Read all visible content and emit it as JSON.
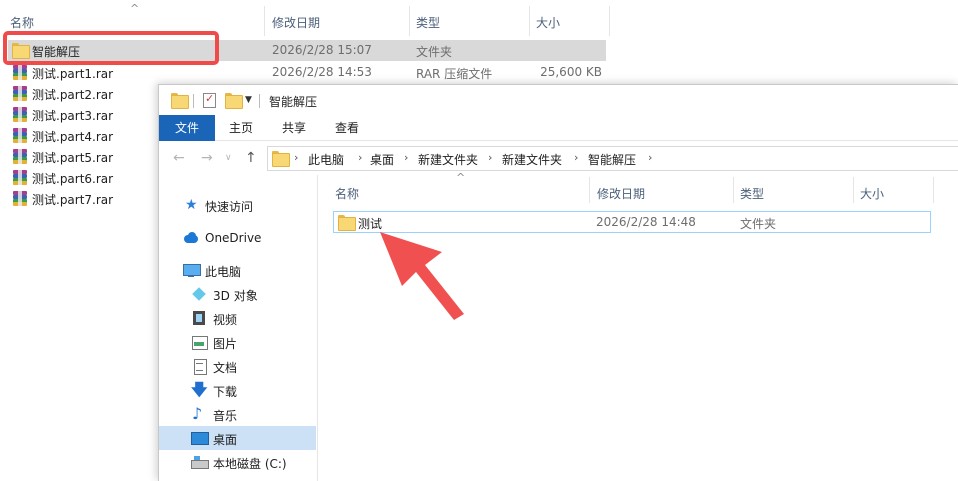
{
  "background": {
    "columns": {
      "name": "名称",
      "date": "修改日期",
      "type": "类型",
      "size": "大小"
    },
    "sort_arrow": "^",
    "rows": [
      {
        "name": "智能解压",
        "date": "2026/2/28 15:07",
        "type": "文件夹",
        "size": "",
        "icon": "folder-icon"
      },
      {
        "name": "测试.part1.rar",
        "date": "2026/2/28 14:53",
        "type": "RAR 压缩文件",
        "size": "25,600 KB",
        "icon": "rar-icon"
      },
      {
        "name": "测试.part2.rar",
        "icon": "rar-icon"
      },
      {
        "name": "测试.part3.rar",
        "icon": "rar-icon"
      },
      {
        "name": "测试.part4.rar",
        "icon": "rar-icon"
      },
      {
        "name": "测试.part5.rar",
        "icon": "rar-icon"
      },
      {
        "name": "测试.part6.rar",
        "icon": "rar-icon"
      },
      {
        "name": "测试.part7.rar",
        "icon": "rar-icon"
      }
    ],
    "highlight_color": "#ef4b4b"
  },
  "window": {
    "title": "智能解压",
    "ribbon_tabs": [
      "文件",
      "主页",
      "共享",
      "查看"
    ],
    "address": [
      "此电脑",
      "桌面",
      "新建文件夹",
      "新建文件夹",
      "智能解压"
    ],
    "nav_items": [
      {
        "label": "快速访问",
        "icon": "star-icon"
      },
      {
        "label": "OneDrive",
        "icon": "cloud-icon"
      },
      {
        "label": "此电脑",
        "icon": "computer-icon"
      },
      {
        "label": "3D 对象",
        "icon": "cube-icon"
      },
      {
        "label": "视频",
        "icon": "video-icon"
      },
      {
        "label": "图片",
        "icon": "picture-icon"
      },
      {
        "label": "文档",
        "icon": "document-icon"
      },
      {
        "label": "下载",
        "icon": "download-icon"
      },
      {
        "label": "音乐",
        "icon": "music-icon"
      },
      {
        "label": "桌面",
        "icon": "desktop-icon",
        "selected": true
      },
      {
        "label": "本地磁盘 (C:)",
        "icon": "drive-icon"
      }
    ],
    "columns": {
      "name": "名称",
      "date": "修改日期",
      "type": "类型",
      "size": "大小"
    },
    "items": [
      {
        "name": "测试",
        "date": "2026/2/28 14:48",
        "type": "文件夹"
      }
    ],
    "accent": "#1a65b7",
    "arrow_color": "#f05050"
  }
}
